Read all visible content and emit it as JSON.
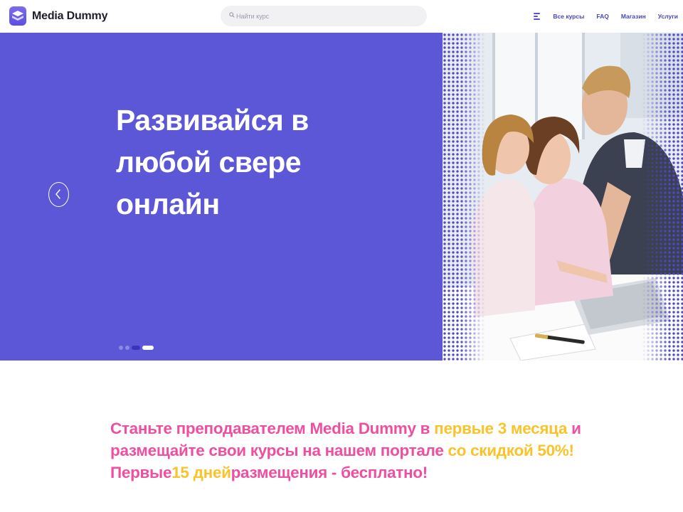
{
  "header": {
    "brand": "Media Dummy",
    "search_placeholder": "Найти курс",
    "nav": [
      "Все курсы",
      "FAQ",
      "Магазин",
      "Услуги"
    ]
  },
  "hero": {
    "heading_lines": [
      "Развивайся в",
      "любой свере",
      "онлайн"
    ],
    "slides": 4,
    "active_slide": 3
  },
  "promo": {
    "line1": [
      "Станьте преподавателем Media Dummy в ",
      "первые 3 месяца",
      " и"
    ],
    "line2": [
      "размещайте свои курсы на нашем портале ",
      "со скидкой 50%!"
    ],
    "line3": [
      "Первые",
      "15 дней",
      "размещения - бесплатно!"
    ]
  },
  "colors": {
    "brand": "#5b4fe0",
    "hero_bg": "#5c57d6",
    "promo_pink": "#ee4fa0",
    "promo_yellow": "#f9c32a"
  },
  "icons": [
    "logo-icon",
    "search-icon",
    "menu-icon",
    "chevron-left-icon"
  ]
}
